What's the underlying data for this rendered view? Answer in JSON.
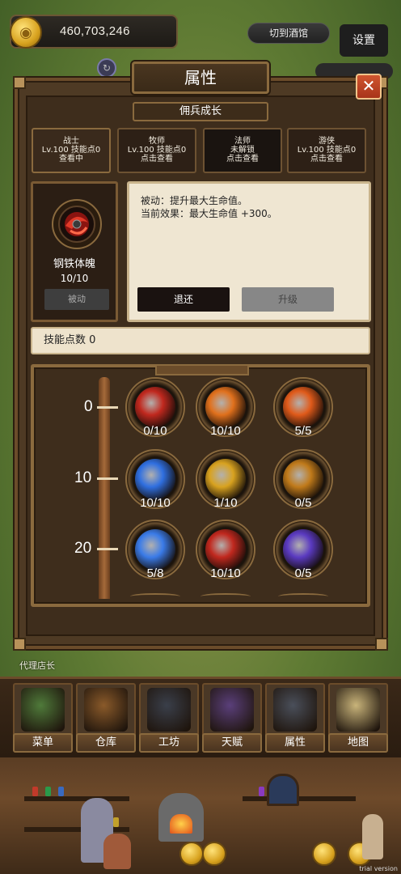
{
  "top_bar": {
    "coins": "460,703,246",
    "tavern_button": "切到酒馆",
    "settings_button": "设置"
  },
  "panel": {
    "title": "属性",
    "subtitle": "佣兵成长",
    "close_symbol": "✕"
  },
  "class_tabs": [
    {
      "name": "战士",
      "line2": "Lv.100  技能点0",
      "line3": "查看中"
    },
    {
      "name": "牧师",
      "line2": "Lv.100  技能点0",
      "line3": "点击查看"
    },
    {
      "name": "法师",
      "line2": "未解锁",
      "line3": "点击查看"
    },
    {
      "name": "游侠",
      "line2": "Lv.100  技能点0",
      "line3": "点击查看"
    }
  ],
  "selected_skill": {
    "name": "钢铁体魄",
    "level": "10/10",
    "type": "被动",
    "description_line1": "被动：提升最大生命值。",
    "description_line2": "当前效果：最大生命值 +300。",
    "refund_button": "退还",
    "upgrade_button": "升级"
  },
  "skill_points": "技能点数 0",
  "skill_tree": {
    "tiers": [
      "0",
      "10",
      "20"
    ],
    "nodes": [
      {
        "count": "0/10",
        "icon": "iron-body-icon",
        "color": "#c0281e"
      },
      {
        "count": "10/10",
        "icon": "slash-sword-icon",
        "color": "#e0701c"
      },
      {
        "count": "5/5",
        "icon": "fire-sword-icon",
        "color": "#e05a1a"
      },
      {
        "count": "10/10",
        "icon": "whirlwind-icon",
        "color": "#2f6fe0"
      },
      {
        "count": "1/10",
        "icon": "golden-strike-icon",
        "color": "#d8a21f"
      },
      {
        "count": "0/5",
        "icon": "shadow-strike-icon",
        "color": "#c07a1a"
      },
      {
        "count": "5/8",
        "icon": "blue-blade-icon",
        "color": "#3a7be8"
      },
      {
        "count": "10/10",
        "icon": "crimson-guard-icon",
        "color": "#c0281e"
      },
      {
        "count": "0/5",
        "icon": "void-vortex-icon",
        "color": "#5a3ac0"
      }
    ]
  },
  "manager_label": "代理店长",
  "nav": [
    {
      "label": "菜单",
      "icon": "book-icon",
      "color": "#4f7a3a"
    },
    {
      "label": "仓库",
      "icon": "chest-icon",
      "color": "#8a5a2a"
    },
    {
      "label": "工坊",
      "icon": "anvil-icon",
      "color": "#3a3f4a"
    },
    {
      "label": "天赋",
      "icon": "crystal-tree-icon",
      "color": "#5a3f7a"
    },
    {
      "label": "属性",
      "icon": "armor-icon",
      "color": "#4a4f5a"
    },
    {
      "label": "地图",
      "icon": "map-icon",
      "color": "#c9b47a"
    }
  ],
  "watermark": "trial version"
}
